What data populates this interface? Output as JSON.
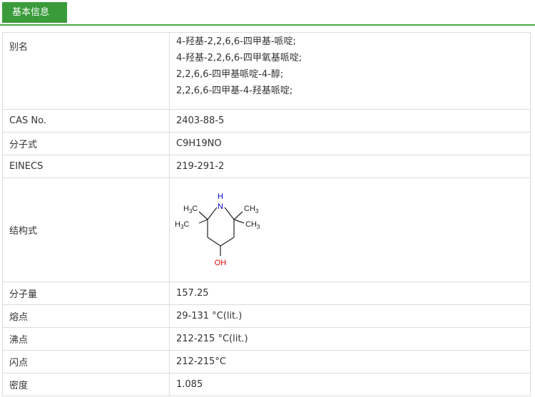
{
  "header": {
    "tab_label": "基本信息"
  },
  "colors": {
    "accent": "#3a9b3a",
    "hetero_n": "#0000cc",
    "hetero_o": "#e00000"
  },
  "rows": {
    "aliases": {
      "label": "别名",
      "values": [
        "4-羟基-2,2,6,6-四甲基-哌啶;",
        "4-羟基-2,2,6,6-四甲氧基哌啶;",
        "2,2,6,6-四甲基哌啶-4-醇;",
        "2,2,6,6-四甲基-4-羟基哌啶;"
      ]
    },
    "cas": {
      "label": "CAS No.",
      "value": "2403-88-5"
    },
    "formula": {
      "label": "分子式",
      "value": "C9H19NO"
    },
    "einecs": {
      "label": "EINECS",
      "value": "219-291-2"
    },
    "structure": {
      "label": "结构式",
      "atoms": {
        "n": "N",
        "h": "H",
        "oh": "OH",
        "ch3": "CH",
        "h3c": "H",
        "c": "C",
        "sub3": "3"
      }
    },
    "mw": {
      "label": "分子量",
      "value": "157.25"
    },
    "mp": {
      "label": "熔点",
      "value": "29-131 °C(lit.)"
    },
    "bp": {
      "label": "沸点",
      "value": "212-215 °C(lit.)"
    },
    "fp": {
      "label": "闪点",
      "value": "212-215°C"
    },
    "density": {
      "label": "密度",
      "value": "1.085"
    }
  }
}
